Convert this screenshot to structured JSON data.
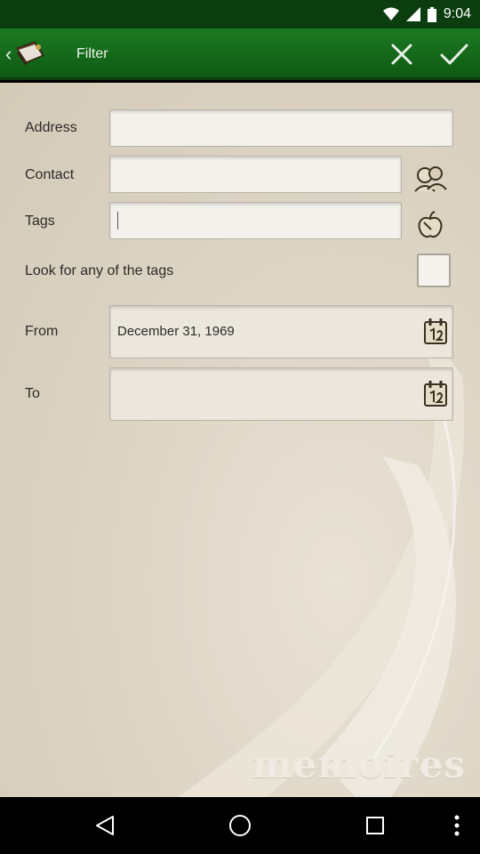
{
  "status_bar": {
    "time": "9:04"
  },
  "action_bar": {
    "title": "Filter"
  },
  "form": {
    "address": {
      "label": "Address",
      "value": ""
    },
    "contact": {
      "label": "Contact",
      "value": ""
    },
    "tags": {
      "label": "Tags",
      "value": ""
    },
    "any_tags": {
      "label": "Look for any of the tags",
      "checked": false
    },
    "from": {
      "label": "From",
      "value": "December 31, 1969"
    },
    "to": {
      "label": "To",
      "value": ""
    }
  },
  "watermark": "memoires",
  "icons": {
    "back": "chevron-left-icon",
    "app": "book-icon",
    "cancel": "close-icon",
    "confirm": "checkmark-icon",
    "contact": "contacts-icon",
    "tags": "tag-apple-icon",
    "calendar": "calendar-icon"
  },
  "colors": {
    "action_bar": "#1c7a22",
    "status_bar": "#0b3d0f",
    "background": "#ddd5c5"
  }
}
